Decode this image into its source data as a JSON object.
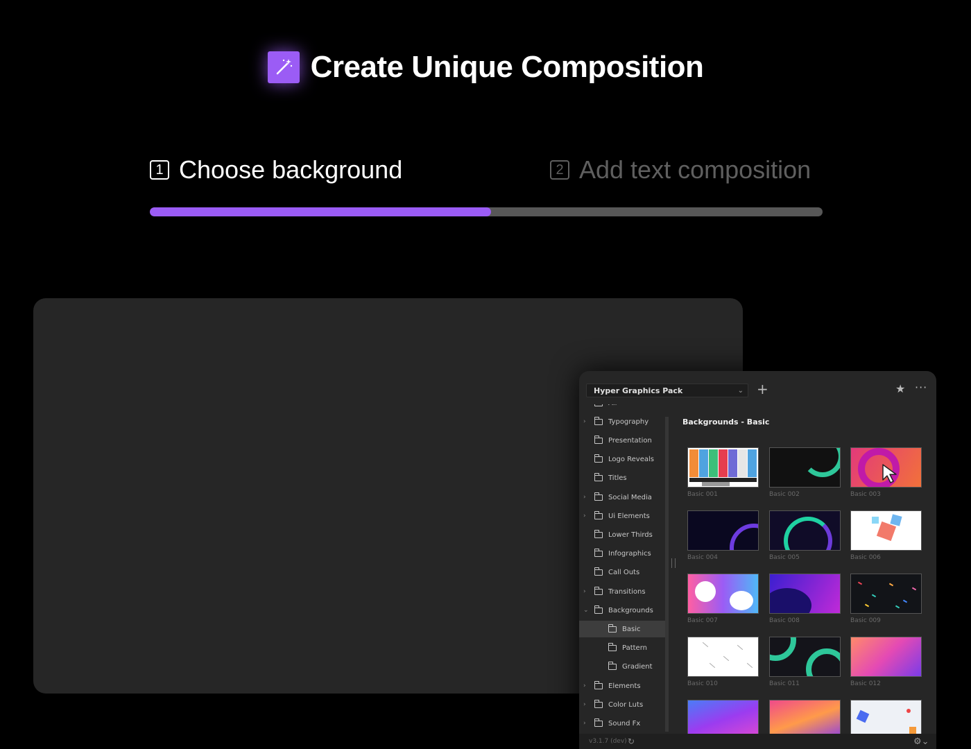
{
  "header": {
    "title": "Create Unique Composition",
    "icon": "magic-wand-icon",
    "accent": "#9b5cf5"
  },
  "steps": [
    {
      "number": "1",
      "label": "Choose background",
      "active": true
    },
    {
      "number": "2",
      "label": "Add text composition",
      "active": false
    }
  ],
  "progress": {
    "fraction": 0.507,
    "fill_color": "#9b5cf5",
    "track_color": "#575757"
  },
  "panel": {
    "pack_select": "Hyper Graphics Pack",
    "section_title": "Backgrounds - Basic",
    "tree": [
      {
        "label": "All",
        "expandable": false,
        "level": 0
      },
      {
        "label": "Typography",
        "expandable": true,
        "level": 0
      },
      {
        "label": "Presentation",
        "expandable": false,
        "level": 0
      },
      {
        "label": "Logo Reveals",
        "expandable": false,
        "level": 0
      },
      {
        "label": "Titles",
        "expandable": false,
        "level": 0
      },
      {
        "label": "Social Media",
        "expandable": true,
        "level": 0
      },
      {
        "label": "Ui Elements",
        "expandable": true,
        "level": 0
      },
      {
        "label": "Lower Thirds",
        "expandable": false,
        "level": 0
      },
      {
        "label": "Infographics",
        "expandable": false,
        "level": 0
      },
      {
        "label": "Call Outs",
        "expandable": false,
        "level": 0
      },
      {
        "label": "Transitions",
        "expandable": true,
        "level": 0
      },
      {
        "label": "Backgrounds",
        "expandable": true,
        "expanded": true,
        "level": 0
      },
      {
        "label": "Basic",
        "level": 1,
        "selected": true
      },
      {
        "label": "Pattern",
        "level": 1
      },
      {
        "label": "Gradient",
        "level": 1
      },
      {
        "label": "Elements",
        "expandable": true,
        "level": 0
      },
      {
        "label": "Color Luts",
        "expandable": true,
        "level": 0
      },
      {
        "label": "Sound Fx",
        "expandable": true,
        "level": 0
      }
    ],
    "thumbnails": [
      {
        "label": "Basic 001",
        "style": "bars"
      },
      {
        "label": "Basic 002",
        "style": "ring-teal"
      },
      {
        "label": "Basic 003",
        "style": "ring-pink"
      },
      {
        "label": "Basic 004",
        "style": "dark-arc"
      },
      {
        "label": "Basic 005",
        "style": "teal-arc"
      },
      {
        "label": "Basic 006",
        "style": "cubes"
      },
      {
        "label": "Basic 007",
        "style": "blobs"
      },
      {
        "label": "Basic 008",
        "style": "purple-wave"
      },
      {
        "label": "Basic 009",
        "style": "confetti"
      },
      {
        "label": "Basic 010",
        "style": "white-lines"
      },
      {
        "label": "Basic 011",
        "style": "teal-rings"
      },
      {
        "label": "Basic 012",
        "style": "pink-gradient"
      },
      {
        "label": "",
        "style": "violet-gradient"
      },
      {
        "label": "",
        "style": "orange-gradient"
      },
      {
        "label": "",
        "style": "light-shapes"
      }
    ],
    "version": "v3.1.7 (dev)"
  }
}
